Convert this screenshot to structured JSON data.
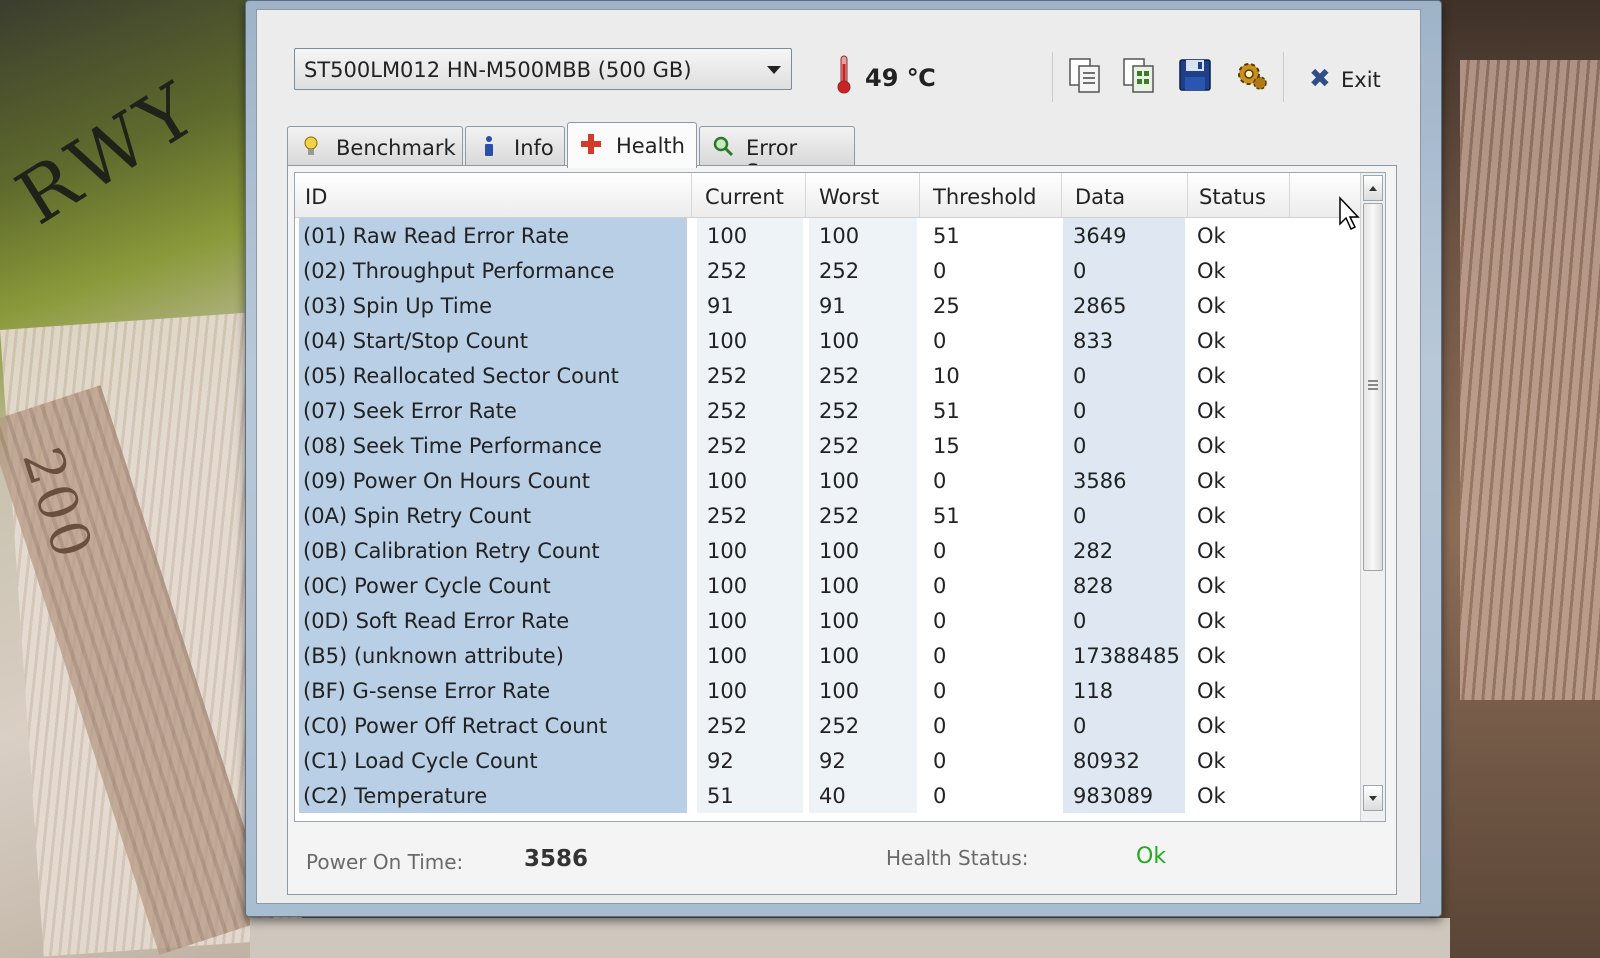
{
  "window": {
    "drive_select": "ST500LM012 HN-M500MBB (500 GB)",
    "temperature": "49 ℃",
    "exit_label": "Exit"
  },
  "toolbar_icons": [
    "copy-icon",
    "copy-all-icon",
    "save-icon",
    "options-icon"
  ],
  "tabs": [
    {
      "label": "Benchmark",
      "icon": "lightbulb-icon"
    },
    {
      "label": "Info",
      "icon": "info-icon"
    },
    {
      "label": "Health",
      "icon": "health-cross-icon",
      "active": true
    },
    {
      "label": "Error Scan",
      "icon": "magnifier-icon"
    }
  ],
  "table": {
    "headers": {
      "id": "ID",
      "current": "Current",
      "worst": "Worst",
      "threshold": "Threshold",
      "data": "Data",
      "status": "Status"
    },
    "rows": [
      {
        "id": "(01) Raw Read Error Rate",
        "current": "100",
        "worst": "100",
        "threshold": "51",
        "data": "3649",
        "status": "Ok"
      },
      {
        "id": "(02) Throughput Performance",
        "current": "252",
        "worst": "252",
        "threshold": "0",
        "data": "0",
        "status": "Ok"
      },
      {
        "id": "(03) Spin Up Time",
        "current": "91",
        "worst": "91",
        "threshold": "25",
        "data": "2865",
        "status": "Ok"
      },
      {
        "id": "(04) Start/Stop Count",
        "current": "100",
        "worst": "100",
        "threshold": "0",
        "data": "833",
        "status": "Ok"
      },
      {
        "id": "(05) Reallocated Sector Count",
        "current": "252",
        "worst": "252",
        "threshold": "10",
        "data": "0",
        "status": "Ok"
      },
      {
        "id": "(07) Seek Error Rate",
        "current": "252",
        "worst": "252",
        "threshold": "51",
        "data": "0",
        "status": "Ok"
      },
      {
        "id": "(08) Seek Time Performance",
        "current": "252",
        "worst": "252",
        "threshold": "15",
        "data": "0",
        "status": "Ok"
      },
      {
        "id": "(09) Power On Hours Count",
        "current": "100",
        "worst": "100",
        "threshold": "0",
        "data": "3586",
        "status": "Ok"
      },
      {
        "id": "(0A) Spin Retry Count",
        "current": "252",
        "worst": "252",
        "threshold": "51",
        "data": "0",
        "status": "Ok"
      },
      {
        "id": "(0B) Calibration Retry Count",
        "current": "100",
        "worst": "100",
        "threshold": "0",
        "data": "282",
        "status": "Ok"
      },
      {
        "id": "(0C) Power Cycle Count",
        "current": "100",
        "worst": "100",
        "threshold": "0",
        "data": "828",
        "status": "Ok"
      },
      {
        "id": "(0D) Soft Read Error Rate",
        "current": "100",
        "worst": "100",
        "threshold": "0",
        "data": "0",
        "status": "Ok"
      },
      {
        "id": "(B5) (unknown attribute)",
        "current": "100",
        "worst": "100",
        "threshold": "0",
        "data": "17388485",
        "status": "Ok"
      },
      {
        "id": "(BF) G-sense Error Rate",
        "current": "100",
        "worst": "100",
        "threshold": "0",
        "data": "118",
        "status": "Ok"
      },
      {
        "id": "(C0) Power Off Retract Count",
        "current": "252",
        "worst": "252",
        "threshold": "0",
        "data": "0",
        "status": "Ok"
      },
      {
        "id": "(C1) Load Cycle Count",
        "current": "92",
        "worst": "92",
        "threshold": "0",
        "data": "80932",
        "status": "Ok"
      },
      {
        "id": "(C2) Temperature",
        "current": "51",
        "worst": "40",
        "threshold": "0",
        "data": "983089",
        "status": "Ok"
      }
    ]
  },
  "footer": {
    "power_on_label": "Power On Time:",
    "power_on_value": "3586",
    "health_label": "Health Status:",
    "health_value": "Ok"
  },
  "background_text": {
    "scribble": "RWY",
    "banknote_number": "200"
  },
  "colors": {
    "health_ok": "#22aa22",
    "id_column_highlight": "#b9cfe6"
  }
}
